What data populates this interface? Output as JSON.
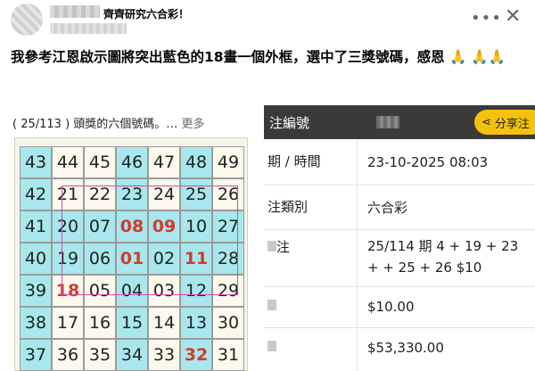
{
  "post": {
    "group_name": "齊齊研究六合彩！",
    "text": "我參考江恩啟示圖將突出藍色的18畫一個外框，選中了三獎號碼，感恩",
    "emoji": "🙏 🙏🙏"
  },
  "left": {
    "caption": "( 25/113 ) 頭獎的六個號碼。…",
    "more": "更多",
    "grid": [
      [
        "43",
        "44",
        "45",
        "46",
        "47",
        "48",
        "49"
      ],
      [
        "42",
        "21",
        "22",
        "23",
        "24",
        "25",
        "26"
      ],
      [
        "41",
        "20",
        "07",
        "08",
        "09",
        "10",
        "27"
      ],
      [
        "40",
        "19",
        "06",
        "01",
        "02",
        "11",
        "28"
      ],
      [
        "39",
        "18",
        "05",
        "04",
        "03",
        "12",
        "29"
      ],
      [
        "38",
        "17",
        "16",
        "15",
        "14",
        "13",
        "30"
      ],
      [
        "37",
        "36",
        "35",
        "34",
        "33",
        "32",
        "31"
      ]
    ],
    "red_numbers": [
      "08",
      "09",
      "01",
      "11",
      "18",
      "32"
    ],
    "blue_columns": [
      0,
      3,
      5
    ]
  },
  "right": {
    "header_title": "注編號",
    "share_label": "分享注",
    "rows": [
      {
        "label": "期 / 時間",
        "value": "23-10-2025 08:03"
      },
      {
        "label": "注類別",
        "value": "六合彩"
      },
      {
        "label": "注",
        "value": "25/114 期 4 + 19 + 23 + + 25 + 26 $10"
      },
      {
        "label": "",
        "value": "$10.00"
      },
      {
        "label": "",
        "value": "$53,330.00"
      }
    ]
  },
  "colors": {
    "blue_cell": "#a8e7ee",
    "cream_cell": "#fbf8ec",
    "red_number": "#d23a2e",
    "frame": "#d24bb0",
    "share_button": "#f4c20d",
    "header_bar": "#3a3a3a"
  }
}
